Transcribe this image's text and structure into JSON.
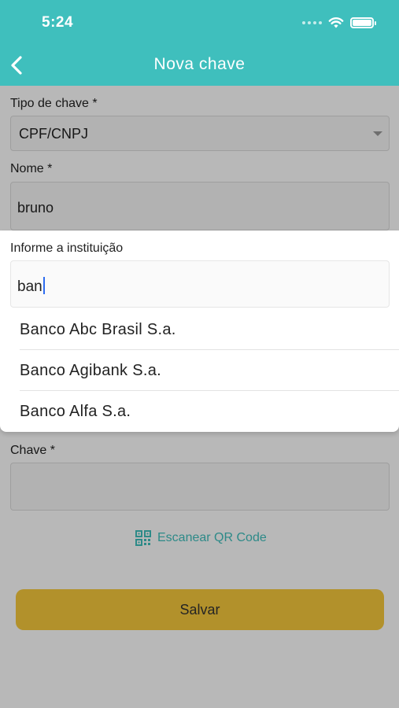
{
  "status_bar": {
    "time": "5:24"
  },
  "header": {
    "title": "Nova chave",
    "back_icon": "chevron-left-icon"
  },
  "form": {
    "tipo_label": "Tipo de chave *",
    "tipo_value": "CPF/CNPJ",
    "nome_label": "Nome *",
    "nome_value": "bruno",
    "chave_label": "Chave *",
    "chave_value": "",
    "scan_label": "Escanear QR Code",
    "scan_icon": "qr-code-icon",
    "save_label": "Salvar"
  },
  "institution_picker": {
    "label": "Informe a instituição",
    "query": "ban",
    "options": [
      {
        "label": "Banco Abc Brasil S.a."
      },
      {
        "label": "Banco Agibank S.a."
      },
      {
        "label": "Banco Alfa S.a."
      }
    ]
  },
  "colors": {
    "accent": "#3fbfbd",
    "save_button": "#f7c93c"
  }
}
